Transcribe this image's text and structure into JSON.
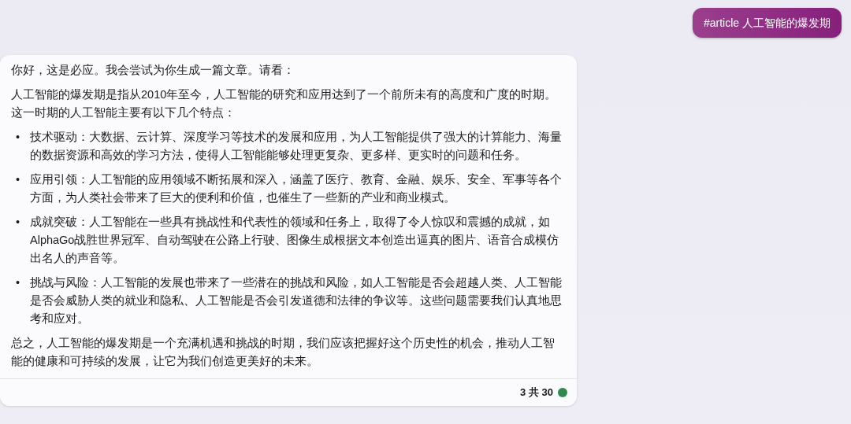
{
  "user_message": {
    "text": "#article 人工智能的爆发期"
  },
  "reply": {
    "paragraphs_before": [
      "你好，这是必应。我会尝试为你生成一篇文章。请看：",
      "人工智能的爆发期是指从2010年至今，人工智能的研究和应用达到了一个前所未有的高度和广度的时期。这一时期的人工智能主要有以下几个特点："
    ],
    "bullets": [
      {
        "marker": "•",
        "text": "技术驱动：大数据、云计算、深度学习等技术的发展和应用，为人工智能提供了强大的计算能力、海量的数据资源和高效的学习方法，使得人工智能能够处理更复杂、更多样、更实时的问题和任务。"
      },
      {
        "marker": "•",
        "text": "应用引领：人工智能的应用领域不断拓展和深入，涵盖了医疗、教育、金融、娱乐、安全、军事等各个方面，为人类社会带来了巨大的便利和价值，也催生了一些新的产业和商业模式。"
      },
      {
        "marker": "•",
        "text": "成就突破：人工智能在一些具有挑战性和代表性的领域和任务上，取得了令人惊叹和震撼的成就，如AlphaGo战胜世界冠军、自动驾驶在公路上行驶、图像生成根据文本创造出逼真的图片、语音合成模仿出名人的声音等。"
      },
      {
        "marker": "•",
        "text": "挑战与风险：人工智能的发展也带来了一些潜在的挑战和风险，如人工智能是否会超越人类、人工智能是否会威胁人类的就业和隐私、人工智能是否会引发道德和法律的争议等。这些问题需要我们认真地思考和应对。"
      }
    ],
    "paragraphs_after": [
      "总之，人工智能的爆发期是一个充满机遇和挑战的时期，我们应该把握好这个历史性的机会，推动人工智能的健康和可持续的发展，让它为我们创造更美好的未来。"
    ],
    "turn_counter": "3 共 30"
  }
}
